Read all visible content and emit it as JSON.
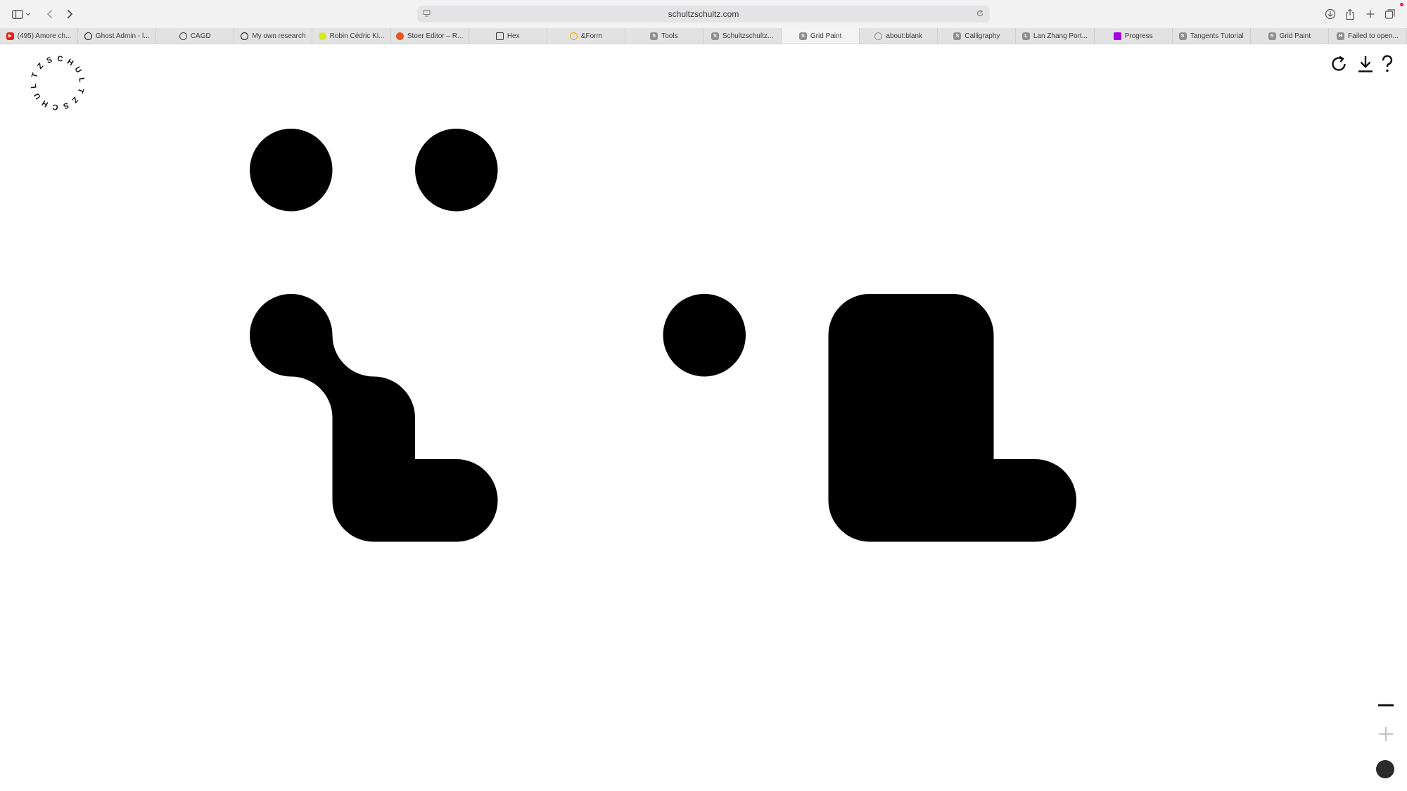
{
  "browser": {
    "url": "schultzschultz.com",
    "tabs": [
      {
        "title": "(495) Amore ch...",
        "favicon": "youtube-icon",
        "color": "#e62117"
      },
      {
        "title": "Ghost Admin - l...",
        "favicon": "ghost-icon",
        "color": "#15171a"
      },
      {
        "title": "CAGD",
        "favicon": "globe-icon",
        "color": "#444444"
      },
      {
        "title": "My own research",
        "favicon": "circle-logo-icon",
        "color": "#15171a"
      },
      {
        "title": "Robin Cédric Ki...",
        "favicon": "yellow-circle-icon",
        "color": "#d6e81a"
      },
      {
        "title": "Stoer Editor – R...",
        "favicon": "orange-circle-icon",
        "color": "#e8561f"
      },
      {
        "title": "Hex",
        "favicon": "hex-icon",
        "color": "#333333"
      },
      {
        "title": "&Form",
        "favicon": "sun-icon",
        "color": "#e6a800"
      },
      {
        "title": "Tools",
        "favicon": "letter-s-icon",
        "color": "#8e8e93",
        "letter": "S"
      },
      {
        "title": "Schultzschultz...",
        "favicon": "letter-s-icon",
        "color": "#8e8e93",
        "letter": "S"
      },
      {
        "title": "Grid Paint",
        "favicon": "letter-s-icon",
        "color": "#8e8e93",
        "letter": "S",
        "active": true
      },
      {
        "title": "about:blank",
        "favicon": "compass-icon",
        "color": "#8e8e93"
      },
      {
        "title": "Calligraphy",
        "favicon": "letter-s-icon",
        "color": "#8e8e93",
        "letter": "S"
      },
      {
        "title": "Lan Zhang Port...",
        "favicon": "letter-l-icon",
        "color": "#8e8e93",
        "letter": "L"
      },
      {
        "title": "Progress",
        "favicon": "purple-square-icon",
        "color": "#a400e0"
      },
      {
        "title": "Tangents Tutorial",
        "favicon": "letter-s-icon",
        "color": "#8e8e93",
        "letter": "S"
      },
      {
        "title": "Grid Paint",
        "favicon": "letter-s-icon",
        "color": "#8e8e93",
        "letter": "S"
      },
      {
        "title": "Failed to open...",
        "favicon": "letter-h-icon",
        "color": "#8e8e93",
        "letter": "H"
      }
    ]
  },
  "logo": {
    "text": "SCHULTZSCHULTZ",
    "ring_text": "SCHULTZSCHULTZ"
  },
  "canvas": {
    "fill_color": "#000000",
    "grid_cells": [
      [
        0,
        0
      ],
      [
        2,
        0
      ],
      [
        0,
        2
      ],
      [
        1,
        3
      ],
      [
        1,
        4
      ],
      [
        2,
        4
      ],
      [
        5,
        2
      ],
      [
        7,
        2
      ],
      [
        8,
        2
      ],
      [
        8,
        3
      ],
      [
        7,
        3
      ],
      [
        7,
        4
      ],
      [
        8,
        4
      ],
      [
        9,
        4
      ]
    ]
  },
  "tools": {
    "reset": "reset-icon",
    "download": "download-icon",
    "help": "help-icon",
    "zoom_out": "minus-icon",
    "zoom_in": "plus-icon",
    "brush_color": "#2b2b2b"
  }
}
